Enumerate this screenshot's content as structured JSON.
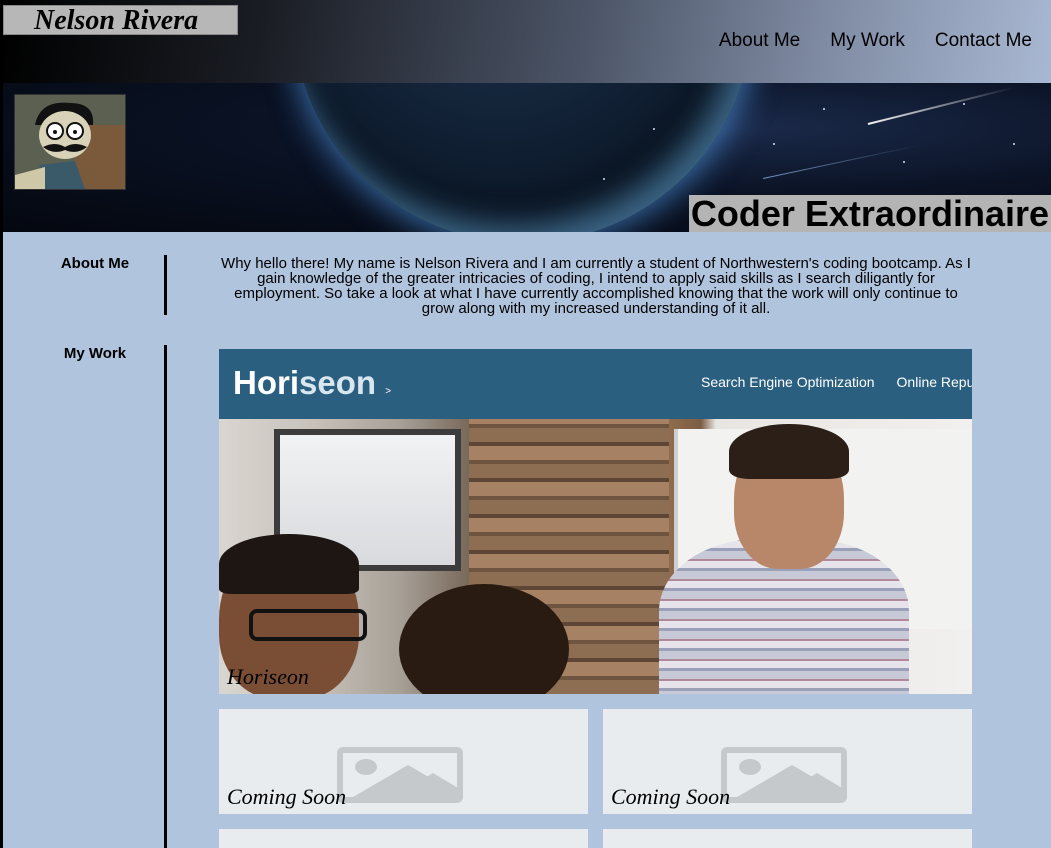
{
  "header": {
    "brand": "Nelson Rivera",
    "nav": [
      {
        "label": "About Me"
      },
      {
        "label": "My Work"
      },
      {
        "label": "Contact Me"
      }
    ]
  },
  "hero": {
    "tagline": "Coder Extraordinaire"
  },
  "about": {
    "heading": "About Me",
    "text": "Why hello there! My name is Nelson Rivera and I am currently a student of Northwestern's coding bootcamp. As I gain knowledge of the greater intricacies of coding, I intend to apply said skills as I search diligantly for employment. So take a look at what I have currently accomplished knowing that the work will only continue to grow along with my increased understanding of it all."
  },
  "work": {
    "heading": "My Work",
    "featured": {
      "caption": "Horiseon",
      "screenshot": {
        "logo_bold": "Hori",
        "logo_light": "seon",
        "logo_caret": ">",
        "links": [
          "Search Engine Optimization",
          "Online Reput"
        ]
      }
    },
    "cards": [
      {
        "caption": "Coming Soon"
      },
      {
        "caption": "Coming Soon"
      }
    ]
  },
  "colors": {
    "page_background": "#b0c4de",
    "brand_box": "#b7b7b7",
    "horiseon_nav": "#2a5f80",
    "card_background": "#e8ecef"
  }
}
